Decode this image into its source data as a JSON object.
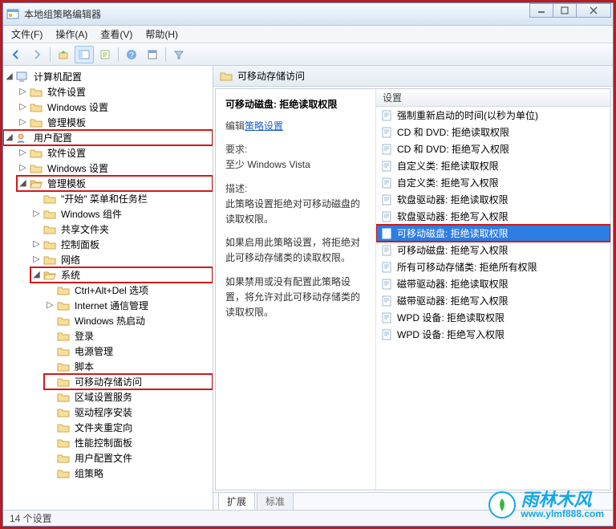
{
  "window": {
    "title": "本地组策略编辑器"
  },
  "menu": {
    "file": "文件(F)",
    "action": "操作(A)",
    "view": "查看(V)",
    "help": "帮助(H)"
  },
  "tree": {
    "computer_config": "计算机配置",
    "cc_software": "软件设置",
    "cc_windows": "Windows 设置",
    "cc_admin": "管理模板",
    "user_config": "用户配置",
    "uc_software": "软件设置",
    "uc_windows": "Windows 设置",
    "uc_admin": "管理模板",
    "start_taskbar": "\"开始\" 菜单和任务栏",
    "win_components": "Windows 组件",
    "shared_folders": "共享文件夹",
    "control_panel": "控制面板",
    "network": "网络",
    "system": "系统",
    "sys_cad": "Ctrl+Alt+Del 选项",
    "sys_internet": "Internet 通信管理",
    "sys_hotstart": "Windows 热启动",
    "sys_login": "登录",
    "sys_power": "电源管理",
    "sys_scripts": "脚本",
    "sys_removable": "可移动存储访问",
    "sys_locale": "区域设置服务",
    "sys_driver": "驱动程序安装",
    "sys_redirect": "文件夹重定向",
    "sys_perf": "性能控制面板",
    "sys_profile": "用户配置文件",
    "sys_policy": "组策略"
  },
  "header": {
    "title": "可移动存储访问"
  },
  "desc": {
    "title": "可移动磁盘: 拒绝读取权限",
    "edit_label": "编辑",
    "edit_link": "策略设置",
    "req_label": "要求:",
    "req_text": "至少 Windows Vista",
    "desc_label": "描述:",
    "desc_text1": "此策略设置拒绝对可移动磁盘的读取权限。",
    "desc_text2": "如果启用此策略设置，将拒绝对此可移动存储类的读取权限。",
    "desc_text3": "如果禁用或没有配置此策略设置，将允许对此可移动存储类的读取权限。"
  },
  "list": {
    "header": "设置",
    "items": [
      "强制重新启动的时间(以秒为单位)",
      "CD 和 DVD: 拒绝读取权限",
      "CD 和 DVD: 拒绝写入权限",
      "自定义类: 拒绝读取权限",
      "自定义类: 拒绝写入权限",
      "软盘驱动器: 拒绝读取权限",
      "软盘驱动器: 拒绝写入权限",
      "可移动磁盘: 拒绝读取权限",
      "可移动磁盘: 拒绝写入权限",
      "所有可移动存储类: 拒绝所有权限",
      "磁带驱动器: 拒绝读取权限",
      "磁带驱动器: 拒绝写入权限",
      "WPD 设备: 拒绝读取权限",
      "WPD 设备: 拒绝写入权限"
    ]
  },
  "tabs": {
    "extended": "扩展",
    "standard": "标准"
  },
  "status": {
    "count": "14 个设置"
  },
  "watermark": {
    "name": "雨林木风",
    "url": "www.ylmf888.com"
  }
}
